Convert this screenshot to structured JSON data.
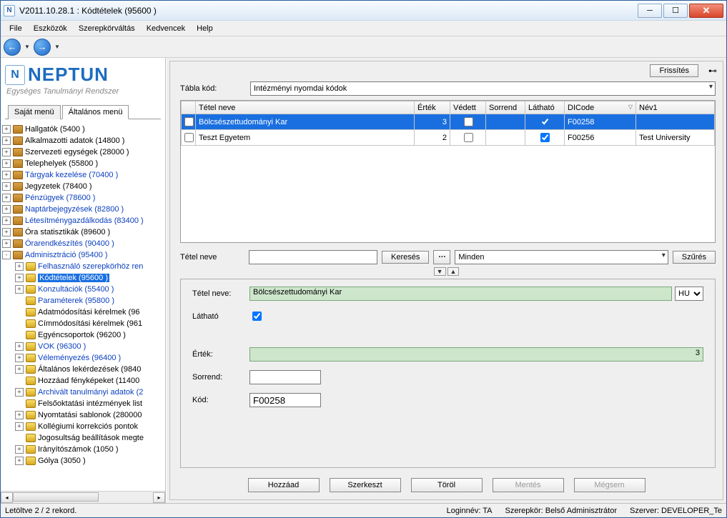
{
  "window": {
    "title": "V2011.10.28.1 : Kódtételek (95600  )"
  },
  "menu": {
    "file": "File",
    "tools": "Eszközök",
    "role": "Szerepkörváltás",
    "fav": "Kedvencek",
    "help": "Help"
  },
  "sidebar": {
    "logo_text": "NEPTUN",
    "logo_sub": "Egységes Tanulmányi Rendszer",
    "tabs": {
      "own": "Saját menü",
      "general": "Általános menü"
    },
    "items": [
      {
        "label": "Hallgatók (5400  )",
        "link": false,
        "lvl": 1,
        "toggle": "+",
        "icon": "book"
      },
      {
        "label": "Alkalmazotti adatok (14800  )",
        "link": false,
        "lvl": 1,
        "toggle": "+",
        "icon": "book"
      },
      {
        "label": "Szervezeti egységek (28000  )",
        "link": false,
        "lvl": 1,
        "toggle": "+",
        "icon": "book"
      },
      {
        "label": "Telephelyek (55800  )",
        "link": false,
        "lvl": 1,
        "toggle": "+",
        "icon": "book"
      },
      {
        "label": "Tárgyak kezelése (70400  )",
        "link": true,
        "lvl": 1,
        "toggle": "+",
        "icon": "book"
      },
      {
        "label": "Jegyzetek (78400  )",
        "link": false,
        "lvl": 1,
        "toggle": "+",
        "icon": "book"
      },
      {
        "label": "Pénzügyek (78600  )",
        "link": true,
        "lvl": 1,
        "toggle": "+",
        "icon": "book"
      },
      {
        "label": "Naptárbejegyzések (82800  )",
        "link": true,
        "lvl": 1,
        "toggle": "+",
        "icon": "book"
      },
      {
        "label": "Létesítménygazdálkodás (83400  )",
        "link": true,
        "lvl": 1,
        "toggle": "+",
        "icon": "book"
      },
      {
        "label": "Óra statisztikák (89600  )",
        "link": false,
        "lvl": 1,
        "toggle": "+",
        "icon": "book"
      },
      {
        "label": "Órarendkészítés (90400  )",
        "link": true,
        "lvl": 1,
        "toggle": "+",
        "icon": "book"
      },
      {
        "label": "Adminisztráció (95400  )",
        "link": true,
        "lvl": 1,
        "toggle": "-",
        "icon": "book"
      },
      {
        "label": "Felhasználó szerepkörhöz ren",
        "link": true,
        "lvl": 2,
        "toggle": "+",
        "icon": "gear"
      },
      {
        "label": "Kódtételek (95600  )",
        "link": true,
        "lvl": 2,
        "toggle": "+",
        "icon": "gear",
        "selected": true
      },
      {
        "label": "Konzultációk (55400  )",
        "link": true,
        "lvl": 2,
        "toggle": "+",
        "icon": "gear"
      },
      {
        "label": "Paraméterek (95800  )",
        "link": true,
        "lvl": 2,
        "toggle": "",
        "icon": "gear"
      },
      {
        "label": "Adatmódosítási kérelmek (96",
        "link": false,
        "lvl": 2,
        "toggle": "",
        "icon": "gear"
      },
      {
        "label": "Címmódosítási kérelmek (961",
        "link": false,
        "lvl": 2,
        "toggle": "",
        "icon": "gear"
      },
      {
        "label": "Egyéncsoportok (96200  )",
        "link": false,
        "lvl": 2,
        "toggle": "",
        "icon": "gear"
      },
      {
        "label": "VOK (96300  )",
        "link": true,
        "lvl": 2,
        "toggle": "+",
        "icon": "gear"
      },
      {
        "label": "Véleményezés (96400  )",
        "link": true,
        "lvl": 2,
        "toggle": "+",
        "icon": "gear"
      },
      {
        "label": "Általános lekérdezések (9840",
        "link": false,
        "lvl": 2,
        "toggle": "+",
        "icon": "gear"
      },
      {
        "label": "Hozzáad fényképeket (11400",
        "link": false,
        "lvl": 2,
        "toggle": "",
        "icon": "gear"
      },
      {
        "label": "Archivált tanulmányi adatok (2",
        "link": true,
        "lvl": 2,
        "toggle": "+",
        "icon": "gear"
      },
      {
        "label": "Felsőoktatási intézmények list",
        "link": false,
        "lvl": 2,
        "toggle": "",
        "icon": "gear"
      },
      {
        "label": "Nyomtatási sablonok (280000",
        "link": false,
        "lvl": 2,
        "toggle": "+",
        "icon": "gear"
      },
      {
        "label": "Kollégiumi korrekciós pontok",
        "link": false,
        "lvl": 2,
        "toggle": "+",
        "icon": "gear"
      },
      {
        "label": "Jogosultság beállítások megte",
        "link": false,
        "lvl": 2,
        "toggle": "",
        "icon": "gear"
      },
      {
        "label": "Irányítószámok (1050  )",
        "link": false,
        "lvl": 2,
        "toggle": "+",
        "icon": "gear"
      },
      {
        "label": "Gólya (3050  )",
        "link": false,
        "lvl": 2,
        "toggle": "+",
        "icon": "gear"
      }
    ]
  },
  "main": {
    "refresh_btn": "Frissítés",
    "tablakod_label": "Tábla kód:",
    "tablakod_value": "Intézményi nyomdai kódok",
    "grid": {
      "headers": {
        "tetel": "Tétel neve",
        "ertek": "Érték",
        "vedett": "Védett",
        "sorrend": "Sorrend",
        "lathato": "Látható",
        "dicode": "DICode",
        "nev1": "Név1"
      },
      "rows": [
        {
          "tetel": "Bölcsészettudományi Kar",
          "ertek": "3",
          "vedett": false,
          "sorrend": "",
          "lathato": true,
          "dicode": "F00258",
          "nev1": "",
          "selected": true
        },
        {
          "tetel": "Teszt Egyetem",
          "ertek": "2",
          "vedett": false,
          "sorrend": "",
          "lathato": true,
          "dicode": "F00256",
          "nev1": "Test University",
          "selected": false
        }
      ]
    },
    "search": {
      "label": "Tétel neve",
      "btn": "Keresés",
      "all": "Minden",
      "filter": "Szűrés"
    },
    "detail": {
      "tetel_label": "Tétel neve:",
      "tetel_value": "Bölcsészettudományi Kar",
      "lang": "HU",
      "lathato_label": "Látható",
      "lathato_checked": true,
      "ertek_label": "Érték:",
      "ertek_value": "3",
      "sorrend_label": "Sorrend:",
      "sorrend_value": "",
      "kod_label": "Kód:",
      "kod_value": "F00258"
    },
    "actions": {
      "add": "Hozzáad",
      "edit": "Szerkeszt",
      "del": "Töröl",
      "save": "Mentés",
      "cancel": "Mégsem"
    }
  },
  "status": {
    "left": "Letöltve 2 / 2 rekord.",
    "login": "Loginnév: TA",
    "role": "Szerepkör: Belső Adminisztrátor",
    "server": "Szerver: DEVELOPER_Te"
  }
}
